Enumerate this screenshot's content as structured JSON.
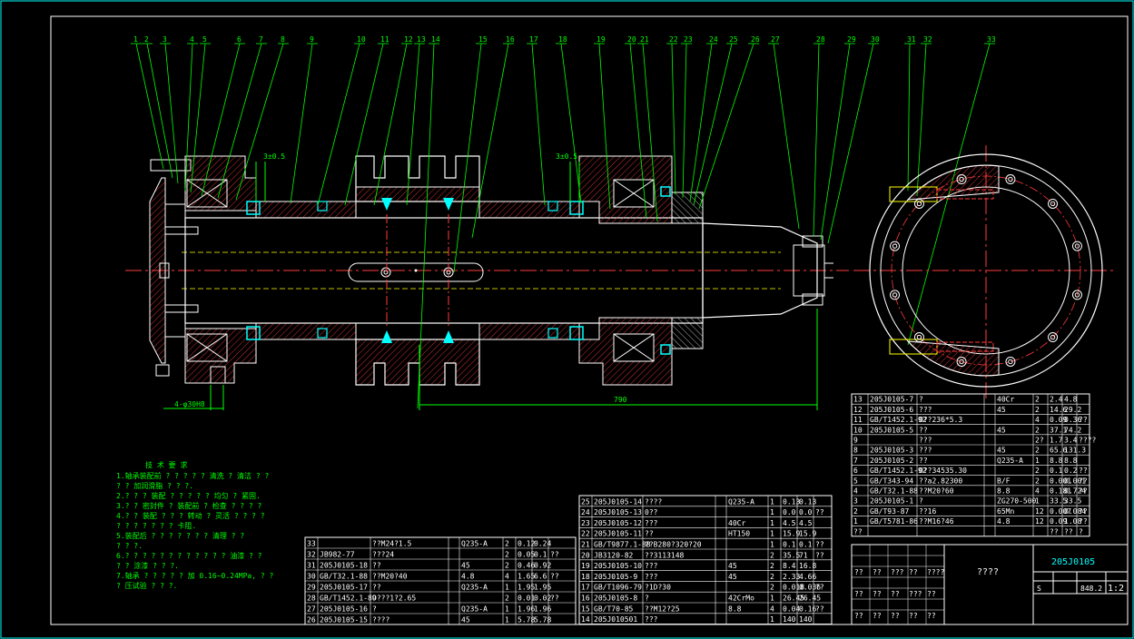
{
  "drawing": {
    "callouts": [
      "1",
      "2",
      "3",
      "4",
      "5",
      "6",
      "7",
      "8",
      "9",
      "10",
      "11",
      "12",
      "13",
      "14",
      "15",
      "16",
      "17",
      "18",
      "19",
      "20",
      "21",
      "22",
      "23",
      "24",
      "25",
      "26",
      "27",
      "28",
      "29",
      "30",
      "31",
      "32",
      "33"
    ],
    "dims": {
      "clearance_left": "3±0.5",
      "clearance_right": "3±0.5",
      "length": "790",
      "bolt_holes": "4-φ30H8"
    }
  },
  "notes": {
    "title": "技 术 要 求",
    "lines": [
      "1.轴承装配前 ? ? ? ? ? 清洗 ? 清洁 ? ?",
      "  ? ? 加润滑脂 ? ? ?.",
      "2.? ? ? 装配 ? ? ? ? ? 均匀 ? 紧固.",
      "3.? ? 密封件 ? 装配前 ? 检查 ? ? ? ?",
      "4.? ? 装配 ? ? ? 转动 ? 灵活 ? ? ? ?",
      "  ? ? ? ? ? ? ? 卡阻.",
      "5.装配后 ? ? ? ? ? ? ? 清理 ? ?",
      "  ? ? ?.",
      "6.? ? ? ? ? ? ? ? ? ? ? ? 油漆 ? ?",
      "  ? ? 涂漆 ? ? ?.",
      "7.轴承 ? ? ? ? ? 加 0.16~0.24MPa, ? ?",
      "  ? 压试验 ? ? ?."
    ]
  },
  "bom_right": [
    [
      "13",
      "205J0105-7",
      "?",
      "",
      "40Cr",
      "2",
      "2.4",
      "4.8",
      ""
    ],
    [
      "12",
      "205J0105-6",
      "???",
      "",
      "45",
      "2",
      "14.6",
      "29.2",
      ""
    ],
    [
      "11",
      "GB/T1452.1-92",
      "O??236*5.3",
      "",
      "",
      "4",
      "0.09",
      "0.36",
      "??"
    ],
    [
      "10",
      "205J0105-5",
      "??",
      "",
      "45",
      "2",
      "37.1",
      "74.2",
      ""
    ],
    [
      "9",
      "",
      "???",
      "",
      "",
      "2?",
      "1.7",
      "3.4",
      "????"
    ],
    [
      "8",
      "205J0105-3",
      "???",
      "",
      "45",
      "2",
      "65.6",
      "131.3",
      ""
    ],
    [
      "7",
      "205J0105-2",
      "??",
      "",
      "Q235-A",
      "1",
      "8.8",
      "8.8",
      ""
    ],
    [
      "6",
      "GB/T1452.1-92",
      "O??34535.30",
      "",
      "",
      "2",
      "0.1",
      "0.2",
      "??"
    ],
    [
      "5",
      "GB/T343-94",
      "??a2.82300",
      "",
      "B/F",
      "2",
      "0.001",
      "0.001",
      "??"
    ],
    [
      "4",
      "GB/T32.1-88",
      "??M20?60",
      "",
      "8.8",
      "4",
      "0.181",
      "0.724",
      "??"
    ],
    [
      "3",
      "205J0105-1",
      "?",
      "",
      "ZG270-500",
      "1",
      "33.5",
      "33.5",
      ""
    ],
    [
      "2",
      "GB/T93-87",
      "??16",
      "",
      "65Mn",
      "12",
      "0.007",
      "0.084",
      "??"
    ],
    [
      "1",
      "GB/T5781-86",
      "??M16?46",
      "",
      "4.8",
      "12",
      "0.09",
      "1.08",
      "??"
    ],
    [
      "??",
      "",
      "",
      "",
      "",
      "",
      "??",
      "??",
      "?"
    ]
  ],
  "bom_mid": [
    [
      "25",
      "205J0105-14",
      "????",
      "",
      "Q235-A",
      "1",
      "0.13",
      "0.13",
      ""
    ],
    [
      "24",
      "205J0105-13",
      "0??",
      "",
      "",
      "1",
      "0.0",
      "0.0",
      "??"
    ],
    [
      "23",
      "205J0105-12",
      "???",
      "",
      "40Cr",
      "1",
      "4.5",
      "4.5",
      ""
    ],
    [
      "22",
      "205J0105-11",
      "??",
      "",
      "HT150",
      "1",
      "15.9",
      "15.9",
      ""
    ],
    [
      "21",
      "GB/T9877.1-88",
      "??B280?320?20",
      "",
      "",
      "1",
      "0.1",
      "0.1",
      "??"
    ],
    [
      "20",
      "JB3120-82",
      "??3113148",
      "",
      "",
      "2",
      "35.5",
      "71",
      "??"
    ],
    [
      "19",
      "205J0105-10",
      "???",
      "",
      "45",
      "2",
      "8.4",
      "16.8",
      ""
    ],
    [
      "18",
      "205J0105-9",
      "???",
      "",
      "45",
      "2",
      "2.33",
      "4.66",
      ""
    ],
    [
      "17",
      "GB/T1096-79",
      "?1D?30",
      "",
      "",
      "2",
      "0.018",
      "0.036",
      "??"
    ],
    [
      "16",
      "205J0105-8",
      "?",
      "",
      "42CrMo",
      "1",
      "26.45",
      "26.45",
      ""
    ],
    [
      "15",
      "GB/T70-85",
      "??M12?25",
      "",
      "8.8",
      "4",
      "0.04",
      "0.16",
      "??"
    ],
    [
      "14",
      "205J010501",
      "???",
      "",
      "",
      "1",
      "140",
      "140",
      ""
    ]
  ],
  "bom_left": [
    [
      "33",
      "",
      "??M24?1.5",
      "",
      "Q235-A",
      "2",
      "0.12",
      "0.24",
      ""
    ],
    [
      "32",
      "JB982-77",
      "???24",
      "",
      "",
      "2",
      "0.05",
      "0.1",
      "??"
    ],
    [
      "31",
      "205J0105-18",
      "??",
      "",
      "45",
      "2",
      "0.46",
      "0.92",
      ""
    ],
    [
      "30",
      "GB/T32.1-88",
      "??M20?40",
      "",
      "4.8",
      "4",
      "1.65",
      "6.6",
      "??"
    ],
    [
      "29",
      "205J0105-17",
      "??",
      "",
      "Q235-A",
      "1",
      "1.95",
      "1.95",
      ""
    ],
    [
      "28",
      "GB/T1452.1-89",
      "O???1?2.65",
      "",
      "",
      "2",
      "0.01",
      "0.02",
      "??"
    ],
    [
      "27",
      "205J0105-16",
      "?",
      "",
      "Q235-A",
      "1",
      "1.96",
      "1.96",
      ""
    ],
    [
      "26",
      "205J0105-15",
      "????",
      "",
      "45",
      "1",
      "5.78",
      "5.78",
      ""
    ]
  ],
  "title_block": {
    "drawing_no": "205J0105",
    "name": "????",
    "mass": "848.2",
    "scale": "1:2",
    "stage": "S",
    "cells": [
      "??",
      "??",
      "???",
      "??",
      "????",
      "??",
      "??",
      "??",
      "???",
      "??",
      "??",
      "??",
      "??",
      "??",
      "??"
    ]
  }
}
